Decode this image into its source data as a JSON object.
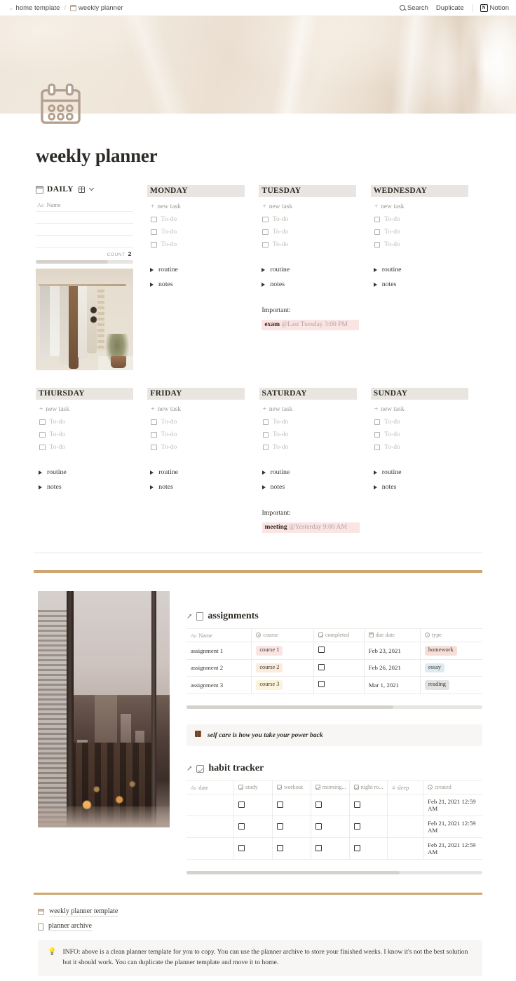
{
  "topbar": {
    "breadcrumb": [
      {
        "icon": "chevron-icon",
        "label": "home template"
      },
      {
        "icon": "calendar-icon",
        "label": "weekly planner"
      }
    ],
    "separator": "/",
    "search_label": "Search",
    "duplicate_label": "Duplicate",
    "notion_label": "Notion",
    "notion_mark": "N"
  },
  "page": {
    "icon": "calendar-icon",
    "title": "weekly planner"
  },
  "daily_db": {
    "icon": "calendar-icon",
    "title": "DAILY",
    "view_icon": "grid-icon",
    "chevron": "chevron-down-icon",
    "column_header": "Name",
    "column_header_type_icon": "Aa",
    "rows": [
      "",
      "",
      ""
    ],
    "count_label": "COUNT",
    "count_value": "2",
    "photo_alt": "clothing-rack-photo"
  },
  "week": {
    "new_task_label": "new task",
    "todo_label": "To-do",
    "routine_label": "routine",
    "notes_label": "notes",
    "important_label": "Important:",
    "days": [
      {
        "name": "MONDAY",
        "todos": [
          "To-do",
          "To-do",
          "To-do"
        ],
        "toggles": [
          "routine",
          "notes"
        ],
        "important": null
      },
      {
        "name": "TUESDAY",
        "todos": [
          "To-do",
          "To-do",
          "To-do"
        ],
        "toggles": [
          "routine",
          "notes"
        ],
        "important": {
          "title": "exam",
          "date": "@Last Tuesday 3:00 PM"
        }
      },
      {
        "name": "WEDNESDAY",
        "todos": [
          "To-do",
          "To-do",
          "To-do"
        ],
        "toggles": [
          "routine",
          "notes"
        ],
        "important": null
      },
      {
        "name": "THURSDAY",
        "todos": [
          "To-do",
          "To-do",
          "To-do"
        ],
        "toggles": [
          "routine",
          "notes"
        ],
        "important": null
      },
      {
        "name": "FRIDAY",
        "todos": [
          "To-do",
          "To-do",
          "To-do"
        ],
        "toggles": [
          "routine",
          "notes"
        ],
        "important": null
      },
      {
        "name": "SATURDAY",
        "todos": [
          "To-do",
          "To-do",
          "To-do"
        ],
        "toggles": [
          "routine",
          "notes"
        ],
        "important": {
          "title": "meeting",
          "date": "@Yesterday 9:00 AM"
        }
      },
      {
        "name": "SUNDAY",
        "todos": [
          "To-do",
          "To-do",
          "To-do"
        ],
        "toggles": [
          "routine",
          "notes"
        ],
        "important": null
      }
    ]
  },
  "city_photo_alt": "city-skyline-window-photo",
  "assignments": {
    "title": "assignments",
    "open_icon": "open-in-new-icon",
    "db_icon": "page-icon",
    "columns": [
      "Name",
      "course",
      "completed",
      "due date",
      "type"
    ],
    "rows": [
      {
        "name": "assignment 1",
        "course": "course 1",
        "completed": false,
        "due_date": "Feb 23, 2021",
        "type": "homework"
      },
      {
        "name": "assignment 2",
        "course": "course 2",
        "completed": false,
        "due_date": "Feb 26, 2021",
        "type": "essay"
      },
      {
        "name": "assignment 3",
        "course": "course 3",
        "completed": false,
        "due_date": "Mar 1, 2021",
        "type": "reading"
      }
    ],
    "tag_colors": {
      "course 1": "#fbe4e4",
      "course 2": "#faebdd",
      "course 3": "#fbf3db",
      "homework": "#f7dfd8",
      "essay": "#ddebf1",
      "reading": "#e3e2e0"
    }
  },
  "quote_callout": {
    "icon": "chocolate-icon",
    "text": "self care is how you take your power back"
  },
  "habit_tracker": {
    "title": "habit tracker",
    "open_icon": "open-in-new-icon",
    "db_icon": "checkbox-icon",
    "columns": [
      "date",
      "study",
      "workout",
      "morning...",
      "night ro...",
      "sleep",
      "created"
    ],
    "rows": [
      {
        "date": "",
        "study": false,
        "workout": false,
        "morning": false,
        "night": false,
        "sleep": "",
        "created": "Feb 21, 2021 12:59 AM"
      },
      {
        "date": "",
        "study": false,
        "workout": false,
        "morning": false,
        "night": false,
        "sleep": "",
        "created": "Feb 21, 2021 12:59 AM"
      },
      {
        "date": "",
        "study": false,
        "workout": false,
        "morning": false,
        "night": false,
        "sleep": "",
        "created": "Feb 21, 2021 12:59 AM"
      }
    ]
  },
  "footer": {
    "links": [
      {
        "icon": "calendar-icon",
        "label": "weekly planner template"
      },
      {
        "icon": "page-icon",
        "label": "planner archive"
      }
    ],
    "info_icon": "lightbulb-icon",
    "info_text": "INFO: above is a clean planner template for you to copy. You can use the planner archive to store your finished weeks. I know it's not the best solution but it should work. You can duplicate the planner template and move it to home."
  },
  "colors": {
    "accent_gold": "#cfa671",
    "day_header_bg": "#e9e6e2",
    "important_bg": "#fbe4e4",
    "callout_bg": "#f7f6f4",
    "page_icon": "#b49f8e"
  }
}
